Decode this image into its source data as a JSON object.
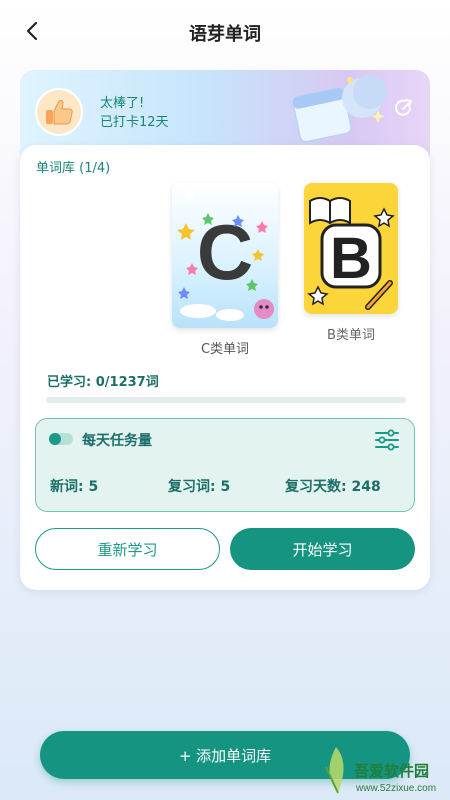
{
  "nav": {
    "title": "语芽单词"
  },
  "banner": {
    "line1": "太棒了!",
    "line2": "已打卡12天"
  },
  "library": {
    "label": "单词库 (1/4)",
    "books": [
      {
        "letter": "C",
        "label": "C类单词"
      },
      {
        "letter": "B",
        "label": "B类单词"
      }
    ]
  },
  "progress": {
    "text": "已学习: 0/1237词",
    "learned": 0,
    "total": 1237
  },
  "task": {
    "title": "每天任务量",
    "new_words": "新词: 5",
    "review_words": "复习词: 5",
    "review_days": "复习天数: 248"
  },
  "buttons": {
    "restart": "重新学习",
    "start": "开始学习",
    "add_library": "+ 添加单词库"
  },
  "watermark": {
    "title": "吾爱软件园",
    "url": "www.52zixue.com"
  },
  "colors": {
    "accent": "#169482",
    "accent_text": "#1d6e68",
    "book_b_bg": "#fcd53a"
  }
}
